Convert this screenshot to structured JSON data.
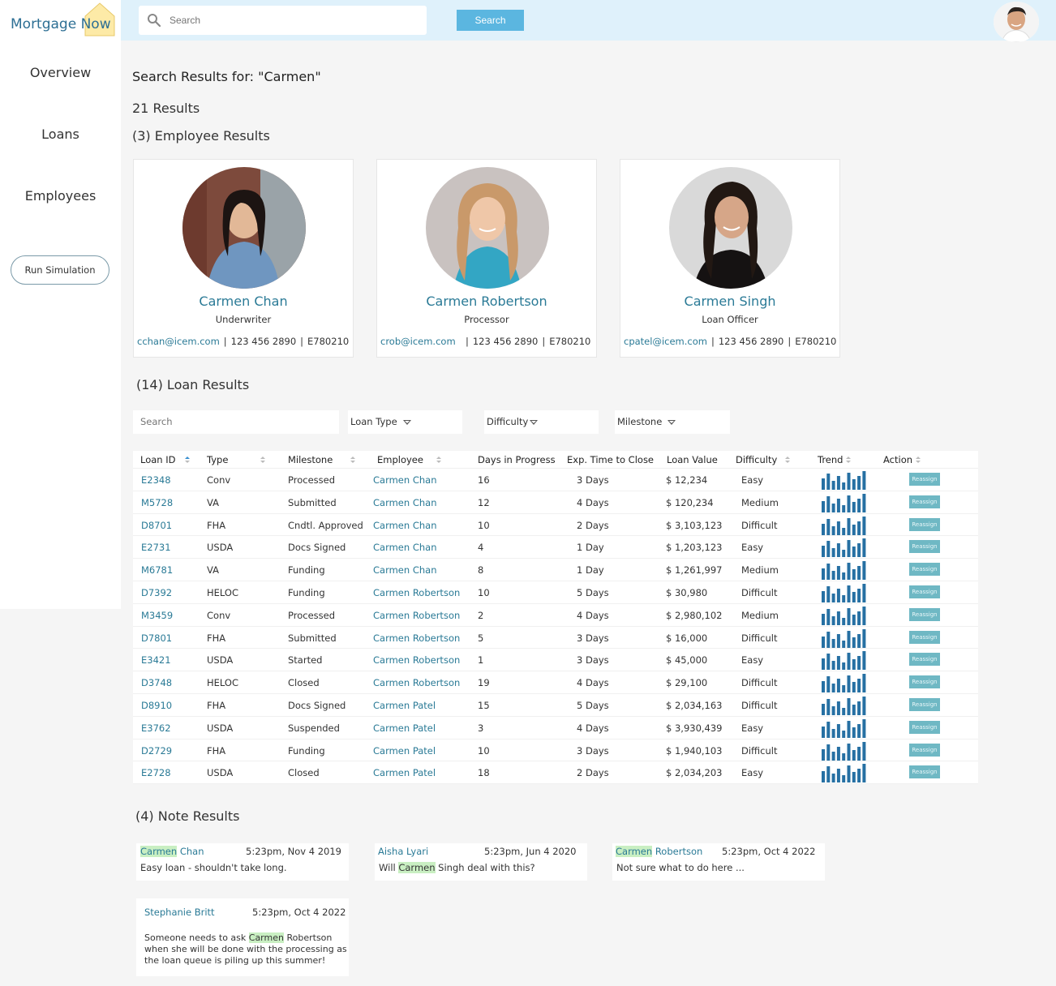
{
  "app": {
    "logo_word1": "Mortgage",
    "logo_word2": "Now",
    "brand_color": "#2d6f94",
    "accent_color": "#5bb6e0"
  },
  "sidebar": {
    "items": [
      {
        "label": "Overview"
      },
      {
        "label": "Loans"
      },
      {
        "label": "Employees"
      }
    ],
    "simulation_button": "Run Simulation"
  },
  "header": {
    "search_placeholder": "Search",
    "search_button": "Search"
  },
  "results": {
    "title": "Search Results for: \"Carmen\"",
    "count": "21 Results",
    "employee_heading": "(3) Employee Results",
    "loan_heading": "(14) Loan Results",
    "note_heading": "(4) Note Results"
  },
  "employees": [
    {
      "name": "Carmen Chan",
      "role": "Underwriter",
      "email": "cchan@icem.com",
      "phone": "123 456 2890",
      "id": "E780210"
    },
    {
      "name": "Carmen Robertson",
      "role": "Processor",
      "email": "crob@icem.com",
      "phone": "123 456 2890",
      "id": "E780210"
    },
    {
      "name": "Carmen Singh",
      "role": "Loan Officer",
      "email": "cpatel@icem.com",
      "phone": "123 456 2890",
      "id": "E780210"
    }
  ],
  "filters": {
    "search_placeholder": "Search",
    "loan_type": "Loan Type",
    "difficulty": "Difficulty",
    "milestone": "Milestone"
  },
  "table": {
    "headers": {
      "loan_id": "Loan ID",
      "type": "Type",
      "milestone": "Milestone",
      "employee": "Employee",
      "days": "Days in Progress",
      "exp": "Exp. Time to Close",
      "value": "Loan Value",
      "difficulty": "Difficulty",
      "trend": "Trend",
      "action": "Action"
    },
    "action_label": "Reassign",
    "rows": [
      {
        "id": "E2348",
        "type": "Conv",
        "milestone": "Processed",
        "employee": "Carmen Chan",
        "days": "16",
        "exp": "3 Days",
        "value": "$ 12,234",
        "difficulty": "Easy"
      },
      {
        "id": "M5728",
        "type": "VA",
        "milestone": "Submitted",
        "employee": "Carmen Chan",
        "days": "12",
        "exp": "4 Days",
        "value": "$ 120,234",
        "difficulty": "Medium"
      },
      {
        "id": "D8701",
        "type": "FHA",
        "milestone": "Cndtl. Approved",
        "employee": "Carmen Chan",
        "days": "10",
        "exp": "2 Days",
        "value": "$ 3,103,123",
        "difficulty": "Difficult"
      },
      {
        "id": "E2731",
        "type": "USDA",
        "milestone": "Docs Signed",
        "employee": "Carmen Chan",
        "days": "4",
        "exp": "1 Day",
        "value": "$ 1,203,123",
        "difficulty": "Easy"
      },
      {
        "id": "M6781",
        "type": "VA",
        "milestone": "Funding",
        "employee": "Carmen Chan",
        "days": "8",
        "exp": "1 Day",
        "value": "$ 1,261,997",
        "difficulty": "Medium"
      },
      {
        "id": "D7392",
        "type": "HELOC",
        "milestone": "Funding",
        "employee": "Carmen Robertson",
        "days": "10",
        "exp": "5 Days",
        "value": "$ 30,980",
        "difficulty": "Difficult"
      },
      {
        "id": "M3459",
        "type": "Conv",
        "milestone": "Processed",
        "employee": "Carmen Robertson",
        "days": "2",
        "exp": "4 Days",
        "value": "$ 2,980,102",
        "difficulty": "Medium"
      },
      {
        "id": "D7801",
        "type": "FHA",
        "milestone": "Submitted",
        "employee": "Carmen Robertson",
        "days": "5",
        "exp": "3 Days",
        "value": "$ 16,000",
        "difficulty": "Difficult"
      },
      {
        "id": "E3421",
        "type": "USDA",
        "milestone": "Started",
        "employee": "Carmen Robertson",
        "days": "1",
        "exp": "3 Days",
        "value": "$ 45,000",
        "difficulty": "Easy"
      },
      {
        "id": "D3748",
        "type": "HELOC",
        "milestone": "Closed",
        "employee": "Carmen Robertson",
        "days": "19",
        "exp": "4 Days",
        "value": "$ 29,100",
        "difficulty": "Difficult"
      },
      {
        "id": "D8910",
        "type": "FHA",
        "milestone": "Docs Signed",
        "employee": "Carmen Patel",
        "days": "15",
        "exp": "5 Days",
        "value": "$ 2,034,163",
        "difficulty": "Difficult"
      },
      {
        "id": "E3762",
        "type": "USDA",
        "milestone": "Suspended",
        "employee": "Carmen Patel",
        "days": "3",
        "exp": "4 Days",
        "value": "$ 3,930,439",
        "difficulty": "Easy"
      },
      {
        "id": "D2729",
        "type": "FHA",
        "milestone": "Funding",
        "employee": "Carmen Patel",
        "days": "10",
        "exp": "3 Days",
        "value": "$ 1,940,103",
        "difficulty": "Difficult"
      },
      {
        "id": "E2728",
        "type": "USDA",
        "milestone": "Closed",
        "employee": "Carmen Patel",
        "days": "18",
        "exp": "2 Days",
        "value": "$ 2,034,203",
        "difficulty": "Easy"
      }
    ]
  },
  "notes": [
    {
      "author_hl": "Carmen",
      "author_rest": " Chan",
      "time": "5:23pm, Nov 4 2019",
      "lines": [
        {
          "pre": "Easy loan - shouldn't take long.",
          "hl": "",
          "post": ""
        }
      ]
    },
    {
      "author_hl": "",
      "author_rest": "Aisha Lyari",
      "time": "5:23pm, Jun 4 2020",
      "lines": [
        {
          "pre": "Will ",
          "hl": "Carmen",
          "post": " Singh deal with this?"
        }
      ]
    },
    {
      "author_hl": "Carmen",
      "author_rest": " Robertson",
      "time": "5:23pm, Oct 4 2022",
      "lines": [
        {
          "pre": "Not sure what to do here ...",
          "hl": "",
          "post": ""
        }
      ]
    },
    {
      "author_hl": "",
      "author_rest": "Stephanie Britt",
      "time": "5:23pm, Oct 4 2022",
      "lines": [
        {
          "pre": "Someone needs to ask ",
          "hl": "Carmen",
          "post": " Robertson"
        },
        {
          "pre": "when she will be done with the processing as",
          "hl": "",
          "post": ""
        },
        {
          "pre": "the loan queue is piling up this summer!",
          "hl": "",
          "post": ""
        }
      ]
    }
  ]
}
